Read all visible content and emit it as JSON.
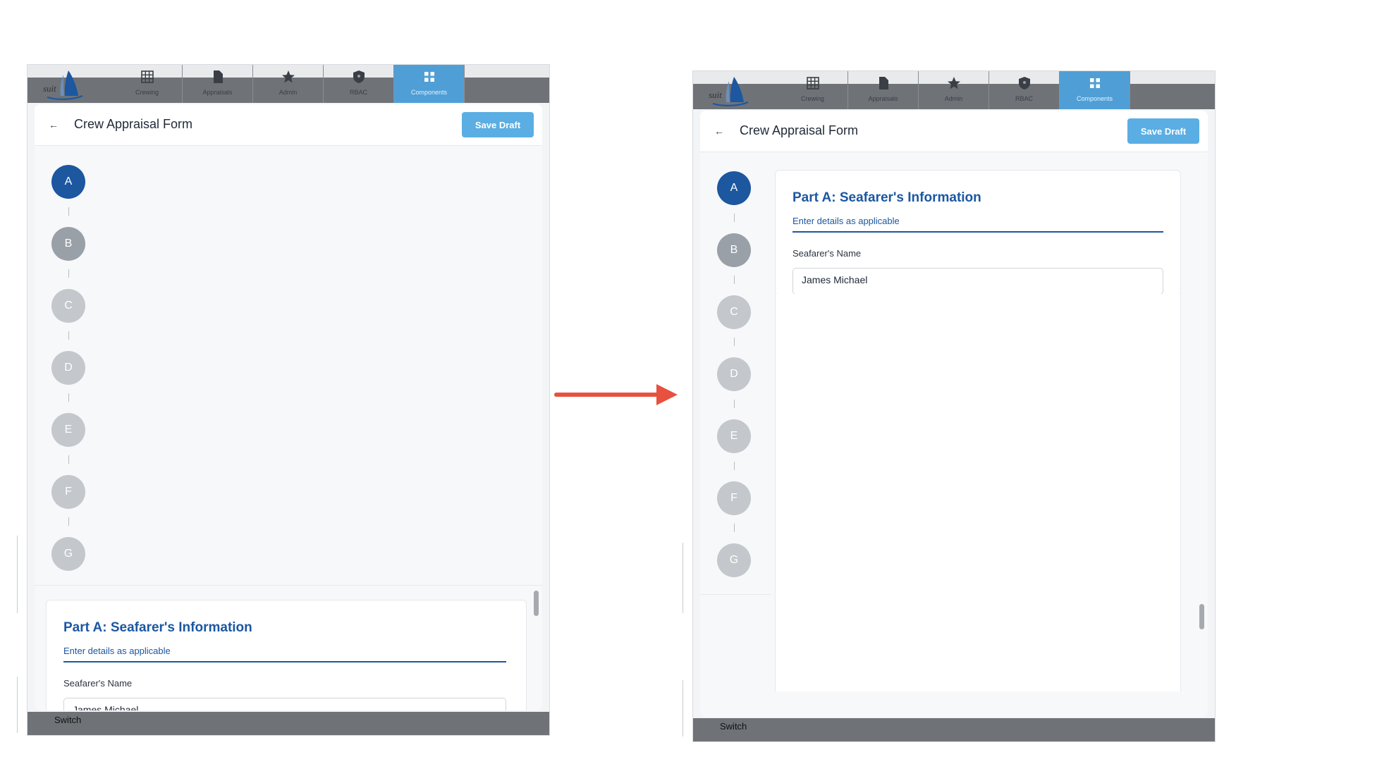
{
  "screens": [
    {
      "nav": {
        "tabs": [
          {
            "label": "Crewing",
            "icon": "grid-icon"
          },
          {
            "label": "Appraisals",
            "icon": "document-icon"
          },
          {
            "label": "Admin",
            "icon": "star-icon"
          },
          {
            "label": "RBAC",
            "icon": "shield-icon"
          },
          {
            "label": "Components",
            "icon": "components-icon",
            "active": true
          }
        ]
      },
      "header": {
        "title": "Crew Appraisal Form",
        "save_label": "Save Draft",
        "back_icon": "←"
      },
      "steps": [
        "A",
        "B",
        "C",
        "D",
        "E",
        "F",
        "G"
      ],
      "card": {
        "title": "Part A: Seafarer's Information",
        "subtitle": "Enter details as applicable",
        "field_label": "Seafarer's Name",
        "field_value": "James Michael"
      },
      "footer": {
        "switch_label": "Switch"
      }
    },
    {
      "nav": {
        "tabs": [
          {
            "label": "Crewing",
            "icon": "grid-icon"
          },
          {
            "label": "Appraisals",
            "icon": "document-icon"
          },
          {
            "label": "Admin",
            "icon": "star-icon"
          },
          {
            "label": "RBAC",
            "icon": "shield-icon"
          },
          {
            "label": "Components",
            "icon": "components-icon",
            "active": true
          }
        ]
      },
      "header": {
        "title": "Crew Appraisal Form",
        "save_label": "Save Draft",
        "back_icon": "←"
      },
      "steps": [
        "A",
        "B",
        "C",
        "D",
        "E",
        "F",
        "G"
      ],
      "card": {
        "title": "Part A: Seafarer's Information",
        "subtitle": "Enter details as applicable",
        "field_label": "Seafarer's Name",
        "field_value": "James Michael"
      },
      "footer": {
        "switch_label": "Switch"
      }
    }
  ],
  "colors": {
    "primary": "#1c57a0",
    "save_button": "#5aaee3",
    "active_tab": "#4f9fd6",
    "arrow": "#e8503f"
  },
  "annotation": {
    "arrow_icon": "right-arrow-icon"
  }
}
